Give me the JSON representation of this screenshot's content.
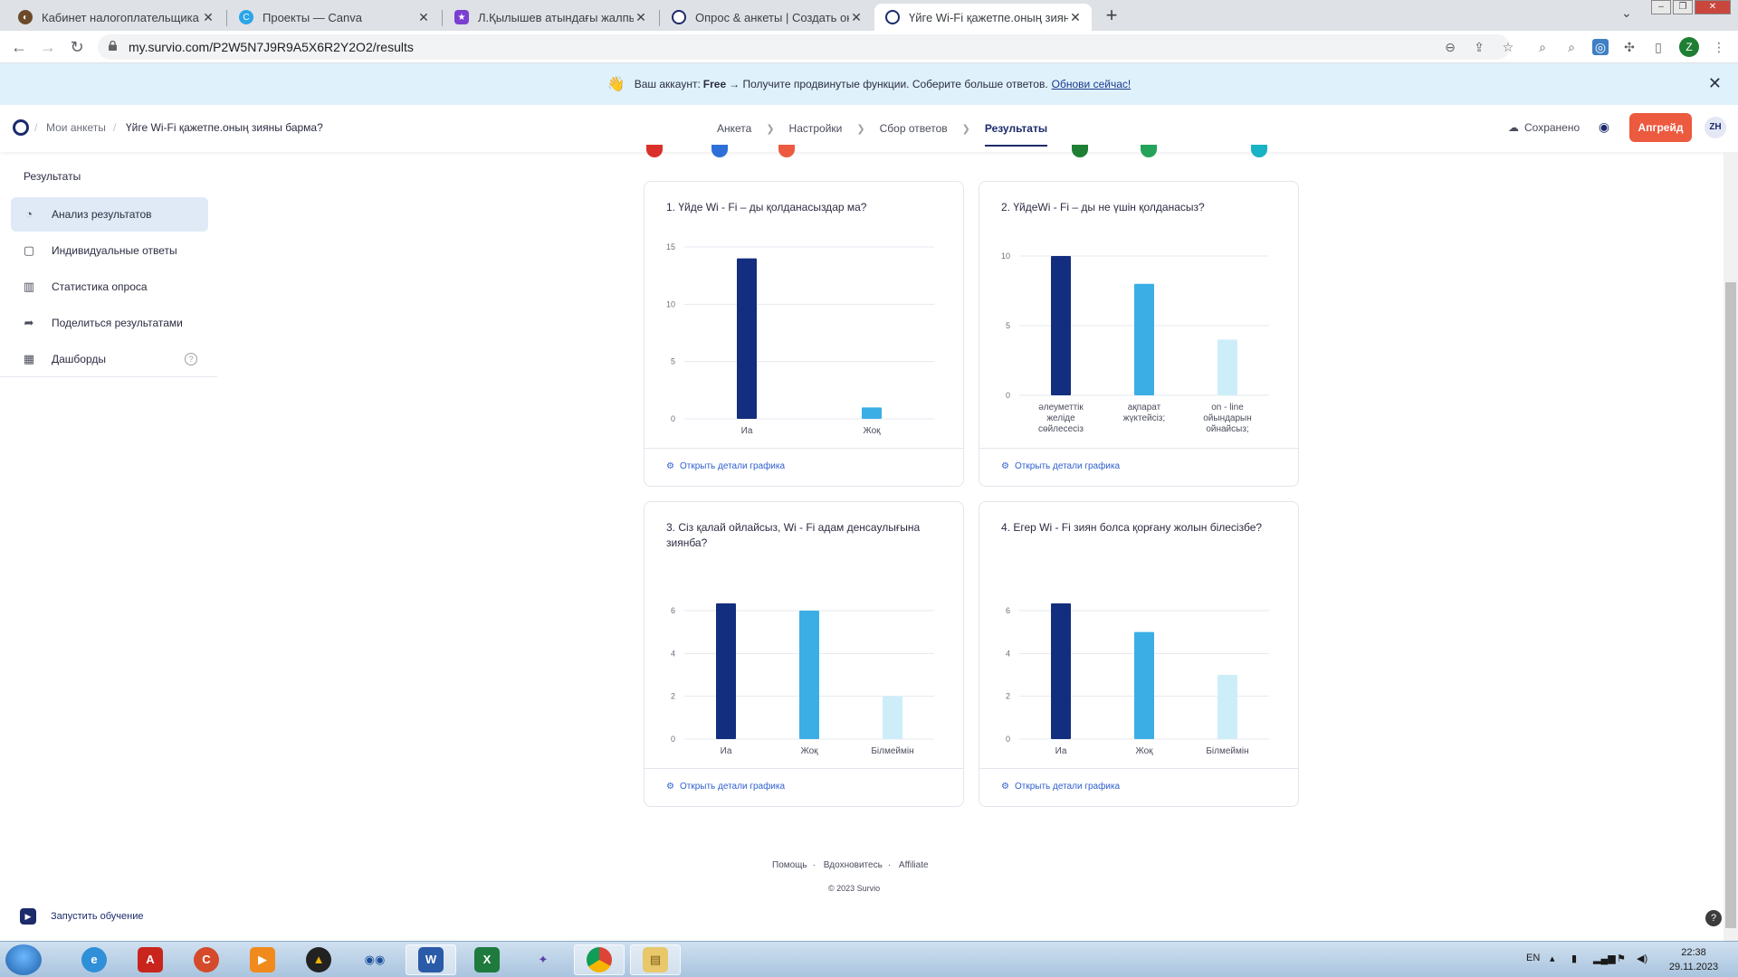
{
  "browser": {
    "tabs": [
      {
        "title": "Кабинет налогоплательщика",
        "color": "#6b4a2a"
      },
      {
        "title": "Проекты — Canva",
        "color": "#2aa5e8"
      },
      {
        "title": "Л.Қылышев атындағы жалпы ор",
        "color": "#7b3fd1"
      },
      {
        "title": "Опрос & анкеты | Создать онла",
        "color": "#1b2b6b"
      },
      {
        "title": "Үйге Wi-Fi қажетпе.оның зияны",
        "color": "#1b2b6b"
      }
    ],
    "url": "my.survio.com/P2W5N7J9R9A5X6R2Y2O2/results",
    "profile_initial": "Z"
  },
  "banner": {
    "prefix": "Ваш аккаунт:",
    "plan": "Free",
    "message": "→ Получите продвинутые функции. Соберите больше ответов.",
    "link": "Обнови сейчас!"
  },
  "header": {
    "crumb_root": "Мои анкеты",
    "crumb_current": "Үйге Wi-Fi қажетпе.оның зияны барма?",
    "steps": [
      "Анкета",
      "Настройки",
      "Сбор ответов",
      "Результаты"
    ],
    "saved": "Сохранено",
    "upgrade": "Апгрейд",
    "user": "ZH"
  },
  "sidebar": {
    "title": "Результаты",
    "items": [
      {
        "label": "Анализ результатов",
        "icon": "pie-chart-icon"
      },
      {
        "label": "Индивидуальные ответы",
        "icon": "chat-icon"
      },
      {
        "label": "Статистика опроса",
        "icon": "bar-stats-icon"
      },
      {
        "label": "Поделиться результатами",
        "icon": "share-icon"
      },
      {
        "label": "Дашборды",
        "icon": "grid-icon"
      }
    ]
  },
  "colors": {
    "dark": "#132e7e",
    "mid": "#3baee6",
    "light": "#cdeef9",
    "accent": "#ec5a3f"
  },
  "cards": [
    {
      "title": "1. Үйде Wi - Fi – ды қолданасыздар ма?",
      "link": "Открыть детали графика"
    },
    {
      "title": "2. ҮйдеWi - Fi – ды не үшін қолданасыз?",
      "link": "Открыть детали графика"
    },
    {
      "title": "3. Сіз қалай ойлайсыз, Wi - Fi адам денсаулығына зиянба?",
      "link": "Открыть детали графика"
    },
    {
      "title": "4. Егер Wi - Fi зиян болса қорғану жолын білесізбе?",
      "link": "Открыть детали графика"
    }
  ],
  "chart_data": [
    {
      "type": "bar",
      "categories": [
        "Иа",
        "Жоқ"
      ],
      "values": [
        14,
        1
      ],
      "ylim": [
        0,
        15
      ],
      "yticks": [
        0,
        5,
        10,
        15
      ]
    },
    {
      "type": "bar",
      "categories": [
        "әлеуметтік желіде сөйлесесіз",
        "ақпарат жүктейсіз;",
        "on - line ойындарын ойнайсыз;"
      ],
      "values": [
        10,
        8,
        4
      ],
      "ylim": [
        0,
        10
      ],
      "yticks": [
        0,
        5,
        10
      ]
    },
    {
      "type": "bar",
      "categories": [
        "Иа",
        "Жоқ",
        "Білмеймін"
      ],
      "values": [
        7,
        6,
        2
      ],
      "ylim": [
        0,
        6
      ],
      "yticks": [
        0,
        2,
        4,
        6
      ]
    },
    {
      "type": "bar",
      "categories": [
        "Иа",
        "Жоқ",
        "Білмеймін"
      ],
      "values": [
        7,
        5,
        3
      ],
      "ylim": [
        0,
        6
      ],
      "yticks": [
        0,
        2,
        4,
        6
      ]
    }
  ],
  "footer": {
    "links": [
      "Помощь",
      "Вдохновитесь",
      "Affiliate"
    ],
    "copyright": "© 2023 Survio",
    "learn": "Запустить обучение"
  },
  "taskbar": {
    "lang": "EN",
    "time": "22:38",
    "date": "29.11.2023"
  }
}
